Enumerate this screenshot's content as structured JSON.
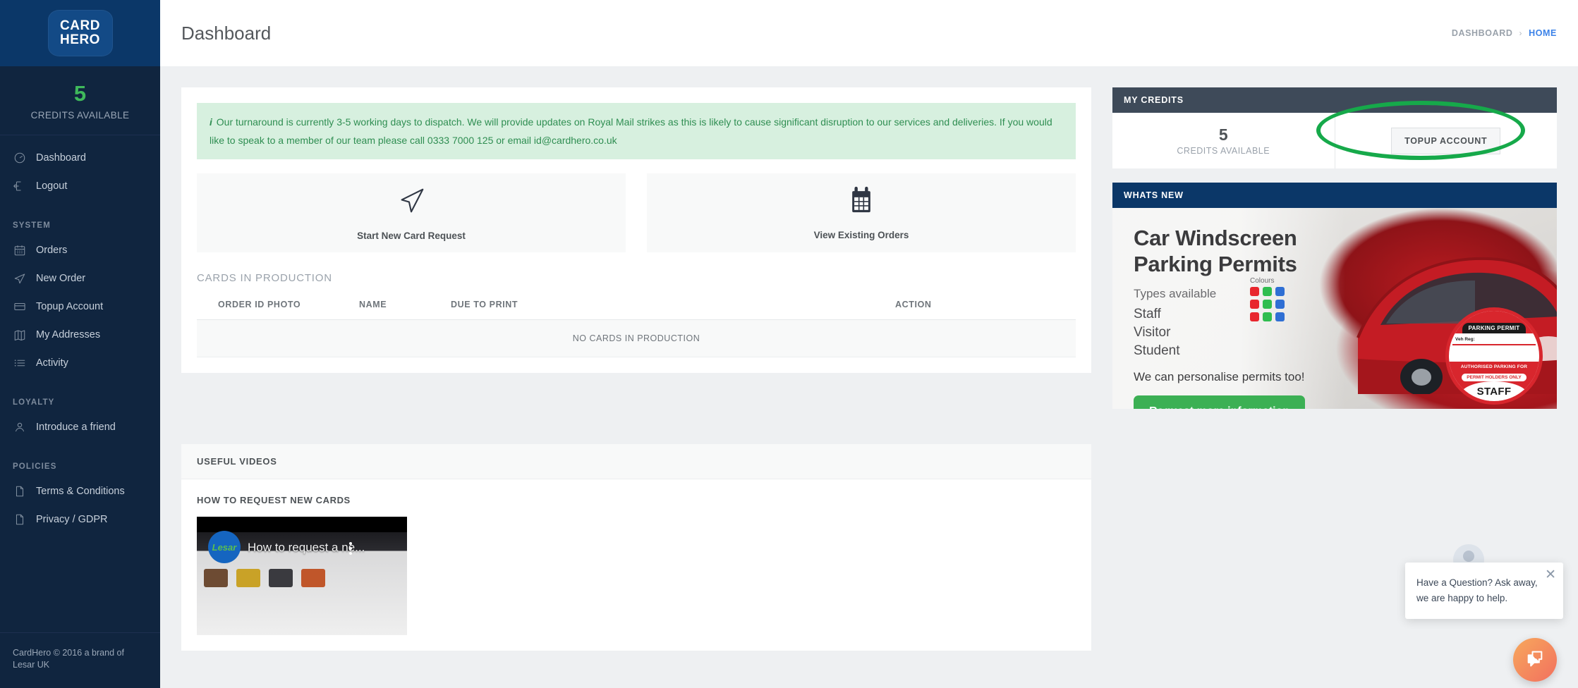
{
  "sidebar": {
    "brand": {
      "line1": "CARD",
      "line2": "HERO"
    },
    "credits": {
      "value": "5",
      "label": "CREDITS AVAILABLE"
    },
    "primary_items": [
      {
        "label": "Dashboard",
        "icon": "gauge-icon"
      },
      {
        "label": "Logout",
        "icon": "logout-icon"
      }
    ],
    "groups": [
      {
        "heading": "SYSTEM",
        "items": [
          {
            "label": "Orders",
            "icon": "calendar-icon"
          },
          {
            "label": "New Order",
            "icon": "paper-plane-icon"
          },
          {
            "label": "Topup Account",
            "icon": "credit-card-icon"
          },
          {
            "label": "My Addresses",
            "icon": "map-icon"
          },
          {
            "label": "Activity",
            "icon": "list-icon"
          }
        ]
      },
      {
        "heading": "LOYALTY",
        "items": [
          {
            "label": "Introduce a friend",
            "icon": "user-icon"
          }
        ]
      },
      {
        "heading": "POLICIES",
        "items": [
          {
            "label": "Terms & Conditions",
            "icon": "document-icon"
          },
          {
            "label": "Privacy / GDPR",
            "icon": "document-icon"
          }
        ]
      }
    ],
    "footer": "CardHero © 2016 a brand of Lesar UK"
  },
  "header": {
    "title": "Dashboard",
    "breadcrumb": {
      "parent": "DASHBOARD",
      "separator": "›",
      "current": "HOME"
    }
  },
  "main": {
    "alert": "Our turnaround is currently 3-5 working days to dispatch. We will provide updates on Royal Mail strikes as this is likely to cause significant disruption to our services and deliveries. If you would like to speak to a member of our team please call 0333 7000 125 or email id@cardhero.co.uk",
    "alert_icon": "info-icon",
    "tiles": [
      {
        "label": "Start New Card Request",
        "icon": "paper-plane-icon"
      },
      {
        "label": "View Existing Orders",
        "icon": "calendar-icon"
      }
    ],
    "production": {
      "title": "CARDS IN PRODUCTION",
      "columns": [
        "ORDER ID",
        "PHOTO",
        "NAME",
        "DUE TO PRINT",
        "",
        "ACTION"
      ],
      "empty_message": "NO CARDS IN PRODUCTION",
      "rows": []
    }
  },
  "credits_card": {
    "heading": "MY CREDITS",
    "value": "5",
    "label": "CREDITS AVAILABLE",
    "button": "TOPUP ACCOUNT",
    "highlight_color": "#16a94a"
  },
  "whats_new": {
    "heading": "WHATS NEW",
    "headline_line1": "Car Windscreen",
    "headline_line2": "Parking Permits",
    "subhead": "Types available",
    "types": [
      "Staff",
      "Visitor",
      "Student"
    ],
    "colours_label": "Colours",
    "swatches": [
      "#e8262d",
      "#2fbd4f",
      "#2f6fd4"
    ],
    "personalise": "We can personalise permits too!",
    "cta": "Request more information",
    "permit": {
      "tag": "PARKING PERMIT",
      "reg_label": "Veh Reg:",
      "authorised": "AUTHORISED PARKING FOR",
      "holders": "PERMIT HOLDERS ONLY",
      "type": "STAFF"
    }
  },
  "videos": {
    "heading": "USEFUL VIDEOS",
    "items": [
      {
        "title": "HOW TO REQUEST NEW CARDS",
        "thumb_title": "How to request a ne...",
        "thumb_logo": "Lesar"
      }
    ]
  },
  "chat": {
    "message": "Have a Question? Ask away, we are happy to help.",
    "close_icon": "close-icon",
    "avatar_icon": "avatar-icon",
    "fab_icon": "chat-icon"
  }
}
